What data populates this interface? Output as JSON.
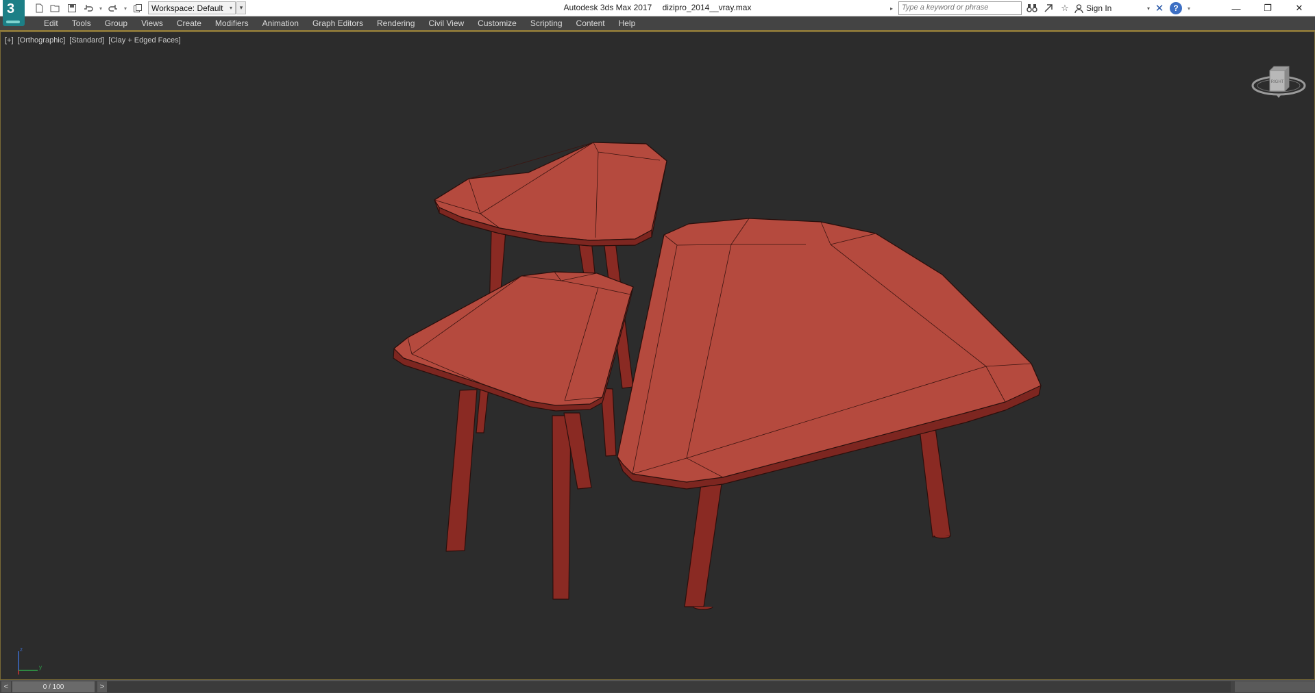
{
  "titlebar": {
    "app_name": "Autodesk 3ds Max 2017",
    "file_name": "dizipro_2014__vray.max",
    "logo_text": "3",
    "workspace_label": "Workspace: Default",
    "search_placeholder": "Type a keyword or phrase",
    "sign_in_label": "Sign In",
    "help_label": "?"
  },
  "menu": {
    "items": [
      "Edit",
      "Tools",
      "Group",
      "Views",
      "Create",
      "Modifiers",
      "Animation",
      "Graph Editors",
      "Rendering",
      "Civil View",
      "Customize",
      "Scripting",
      "Content",
      "Help"
    ]
  },
  "viewport": {
    "label_plus": "[+]",
    "label_view": "[Orthographic]",
    "label_shading": "[Standard]",
    "label_style": "[Clay + Edged Faces]",
    "viewcube_face": "RIGHT",
    "background_color": "#2c2c2c",
    "object_color": "#b54a3e"
  },
  "timeline": {
    "frame_display": "0 / 100",
    "prev_label": "<",
    "next_label": ">"
  },
  "colors": {
    "menubar_bg": "#444444",
    "accent_border": "#8f7a3a",
    "logo_bg": "#1c7f86"
  }
}
